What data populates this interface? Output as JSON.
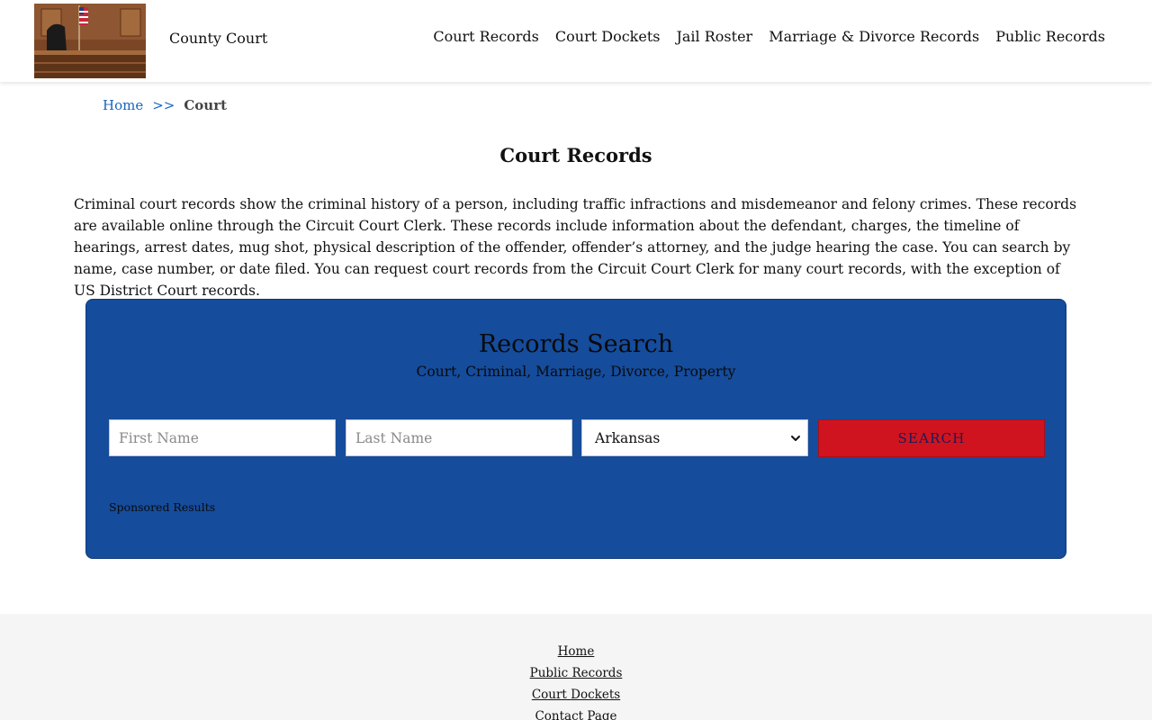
{
  "header": {
    "site_name": "County Court",
    "nav": [
      {
        "label": "Court Records"
      },
      {
        "label": "Court Dockets"
      },
      {
        "label": "Jail Roster"
      },
      {
        "label": "Marriage & Divorce Records"
      },
      {
        "label": "Public Records"
      }
    ]
  },
  "breadcrumb": {
    "home": "Home",
    "separator": ">>",
    "current": "Court"
  },
  "main": {
    "title": "Court Records",
    "intro": "Criminal court records show the criminal history of a person, including traffic infractions and misdemeanor and felony crimes. These records are available online through the Circuit Court Clerk. These records include information about the defendant, charges, the timeline of hearings, arrest dates, mug shot, physical description of the offender, offender’s attorney, and the judge hearing the case. You can search by name, case number, or date filed. You can request court records from the Circuit Court Clerk for many court records, with the exception of US District Court records."
  },
  "search": {
    "title": "Records Search",
    "subtitle": "Court, Criminal, Marriage, Divorce, Property",
    "first_name_placeholder": "First Name",
    "last_name_placeholder": "Last Name",
    "state_selected": "Arkansas",
    "button_label": "SEARCH",
    "sponsored": "Sponsored Results"
  },
  "footer": {
    "links": [
      {
        "label": "Home"
      },
      {
        "label": "Public Records"
      },
      {
        "label": "Court Dockets"
      },
      {
        "label": "Contact Page"
      }
    ]
  },
  "colors": {
    "panel": "#154c9c",
    "button": "#d0141f",
    "link": "#1565c0"
  },
  "icons": {
    "logo": "courtroom-image",
    "select_arrow": "chevron-down-icon"
  }
}
